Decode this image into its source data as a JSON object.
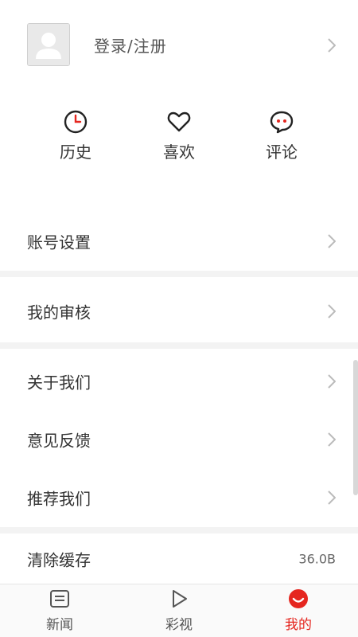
{
  "profile": {
    "login_label": "登录/注册"
  },
  "shortcuts": [
    {
      "label": "历史",
      "icon": "clock-icon"
    },
    {
      "label": "喜欢",
      "icon": "heart-icon"
    },
    {
      "label": "评论",
      "icon": "comment-icon"
    }
  ],
  "menu": {
    "account_settings": "账号设置",
    "my_review": "我的审核",
    "about_us": "关于我们",
    "feedback": "意见反馈",
    "recommend": "推荐我们",
    "clear_cache": "清除缓存",
    "cache_size": "36.0B"
  },
  "tabs": [
    {
      "label": "新闻",
      "icon": "news-icon"
    },
    {
      "label": "彩视",
      "icon": "play-icon"
    },
    {
      "label": "我的",
      "icon": "me-icon"
    }
  ],
  "colors": {
    "accent": "#e5261f",
    "text": "#333333",
    "separator": "#f3f3f3"
  }
}
